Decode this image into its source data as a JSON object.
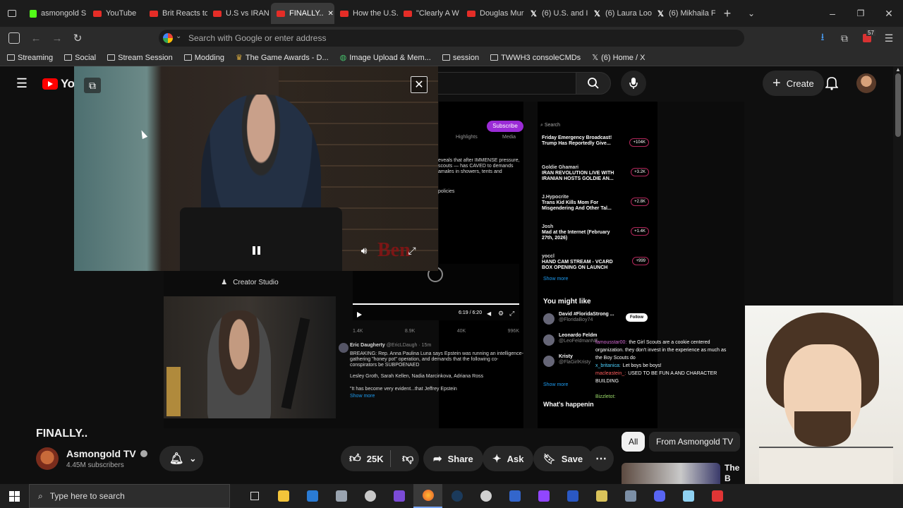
{
  "browser": {
    "tabs": [
      {
        "label": "asmongold S",
        "icon": "kick-icon"
      },
      {
        "label": "YouTube",
        "icon": "youtube-icon"
      },
      {
        "label": "Brit Reacts to",
        "icon": "youtube-icon"
      },
      {
        "label": "U.S vs IRAN |",
        "icon": "youtube-icon"
      },
      {
        "label": "FINALLY..",
        "icon": "youtube-icon"
      },
      {
        "label": "How the U.S.",
        "icon": "youtube-icon"
      },
      {
        "label": "\"Clearly A W",
        "icon": "youtube-icon"
      },
      {
        "label": "Douglas Mur",
        "icon": "youtube-icon"
      },
      {
        "label": "(6) U.S. and I",
        "icon": "x-icon"
      },
      {
        "label": "(6) Laura Loo",
        "icon": "x-icon"
      },
      {
        "label": "(6) Mikhaila F",
        "icon": "x-icon"
      }
    ],
    "address_placeholder": "Search with Google or enter address",
    "extension_badge": "57",
    "bookmarks": [
      "Streaming",
      "Social",
      "Stream Session",
      "Modding",
      "The Game Awards - D...",
      "Image Upload & Mem...",
      "session",
      "TWWH3 consoleCMDs",
      "(6) Home / X"
    ]
  },
  "youtube": {
    "logo": "YouTube",
    "create_label": "Create",
    "miniplayer_creator": "Creator Studio",
    "video_title": "FINALLY..",
    "channel": {
      "name": "Asmongold TV",
      "subscribers": "4.45M subscribers"
    },
    "actions": {
      "likes": "25K",
      "share": "Share",
      "ask": "Ask",
      "save": "Save"
    },
    "chips": [
      "All",
      "From Asmongold TV"
    ],
    "rec_partial_title": "The B Trum"
  },
  "x_embed": {
    "tabs": [
      "Highlights",
      "Media"
    ],
    "subscribe": "Subscribe",
    "search": "Search",
    "post_text": [
      "eveals that after IMMENSE pressure,",
      "scouts — has CAVED to demands",
      "amales in showers, tents and",
      "policies"
    ],
    "video_time": "6:19 / 6:20",
    "stats": [
      "1.4K",
      "8.9K",
      "40K",
      "996K"
    ],
    "second_post": {
      "author": "Eric Daugherty",
      "handle": "@EricLDaugh · 15m",
      "text": "BREAKING: Rep. Anna Paulina Luna says Epstein was running an intelligence-gathering \"honey pot\" operation, and demands that the following co-conspirators be SUBPOENAED",
      "names": "Lesley Groth, Sarah Kellen, Nadia Marcinkova, Adriana Ross",
      "quote": "\"It has become very evident...that Jeffrey Epstein",
      "more": "Show more"
    },
    "spaces": [
      {
        "host": "",
        "title": "Friday Emergency Broadcast! Trump Has Reportedly Give...",
        "count": "+104K"
      },
      {
        "host": "Goldie Ghamari",
        "title": "IRAN REVOLUTION LIVE WITH IRANIAN HOSTS GOLDIE AN...",
        "count": "+3.2K"
      },
      {
        "host": "J.Hypocrite",
        "title": "Trans Kid Kills Mom For Misgendering And Other Tal...",
        "count": "+2.8K"
      },
      {
        "host": "Josh",
        "title": "Mad at the Internet (February 27th, 2026)",
        "count": "+1.4K"
      },
      {
        "host": "yoccl",
        "title": "HAND CAM STREAM - VCARD BOX OPENING ON LAUNCH",
        "count": "+999"
      }
    ],
    "show_more": "Show more",
    "you_might_like": "You might like",
    "suggestions": [
      {
        "name": "David #FloridaStrong ...",
        "handle": "@FloridaBoy74"
      },
      {
        "name": "Leonardo Feldm",
        "handle": "@LeoFeldmanNE"
      },
      {
        "name": "Kristy",
        "handle": "@FlaGirlKristy"
      }
    ],
    "follow": "Follow",
    "whats_happening": "What's happenin"
  },
  "chat": [
    {
      "user": "famousstar00:",
      "msg": "the Girl Scouts are a cookie centered organization. they don't invest in the experience as much as the Boy Scouts do"
    },
    {
      "user": "x_britanica:",
      "msg": "Let boys be boys!"
    },
    {
      "user": "macleastein_:",
      "msg": "USED TO BE FUN A AND CHARACTER BUILDING"
    },
    {
      "user": "",
      "msg": ""
    },
    {
      "user": "Bizzletot:",
      "msg": ""
    }
  ],
  "taskbar": {
    "search_placeholder": "Type here to search"
  }
}
